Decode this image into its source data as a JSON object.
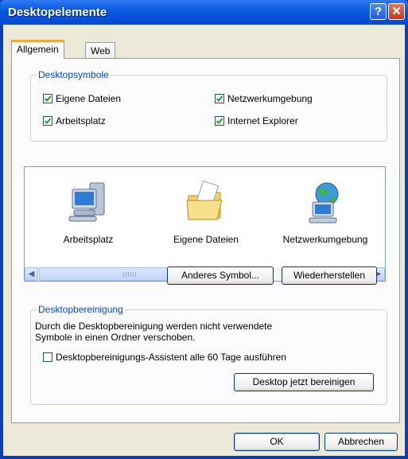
{
  "window": {
    "title": "Desktopelemente",
    "help_glyph": "?",
    "close_glyph": "✕"
  },
  "tabs": [
    {
      "label": "Allgemein",
      "active": true
    },
    {
      "label": "Web",
      "active": false
    }
  ],
  "desktop_icons": {
    "title": "Desktopsymbole",
    "checkboxes": [
      {
        "label": "Eigene Dateien",
        "checked": true
      },
      {
        "label": "Netzwerkumgebung",
        "checked": true
      },
      {
        "label": "Arbeitsplatz",
        "checked": true
      },
      {
        "label": "Internet Explorer",
        "checked": true
      }
    ]
  },
  "icon_list": {
    "items": [
      {
        "label": "Arbeitsplatz",
        "icon": "my-computer-icon"
      },
      {
        "label": "Eigene Dateien",
        "icon": "my-documents-icon"
      },
      {
        "label": "Netzwerkumgebung",
        "icon": "network-places-icon"
      }
    ],
    "scroll_left_glyph": "◀",
    "scroll_right_glyph": "▶"
  },
  "icon_buttons": {
    "change_icon": "Anderes Symbol...",
    "restore": "Wiederherstellen"
  },
  "cleanup": {
    "title": "Desktopbereinigung",
    "description_line1": "Durch die Desktopbereinigung werden nicht verwendete",
    "description_line2": "Symbole in einen Ordner verschoben.",
    "checkbox_label": "Desktopbereinigungs-Assistent alle 60 Tage ausführen",
    "checkbox_checked": false,
    "clean_now_button": "Desktop jetzt bereinigen"
  },
  "footer": {
    "ok": "OK",
    "cancel": "Abbrechen"
  },
  "colors": {
    "title_bar": "#0a5ae0",
    "group_title": "#0046d5",
    "dialog_bg": "#ece9d8",
    "tab_highlight": "#f3a53a"
  }
}
